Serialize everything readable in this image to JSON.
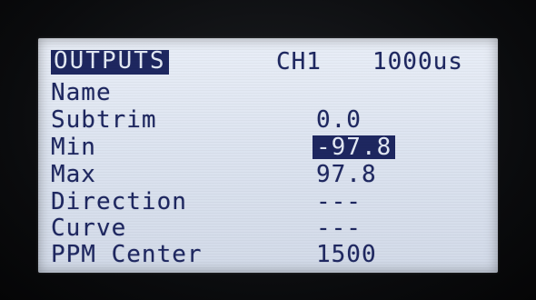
{
  "screen": {
    "title": "OUTPUTS",
    "channel": "CH1",
    "pulse": "1000us"
  },
  "rows": [
    {
      "label": "Name",
      "value": ""
    },
    {
      "label": "Subtrim",
      "value": "0.0"
    },
    {
      "label": "Min",
      "value": "-97.8",
      "selected": true
    },
    {
      "label": "Max",
      "value": "97.8"
    },
    {
      "label": "Direction",
      "value": "---"
    },
    {
      "label": "Curve",
      "value": "---"
    },
    {
      "label": "PPM Center",
      "value": "1500"
    }
  ],
  "colors": {
    "lcd_background": "#e3e9f4",
    "lcd_foreground": "#1e2760",
    "bezel": "#0d0e10"
  }
}
